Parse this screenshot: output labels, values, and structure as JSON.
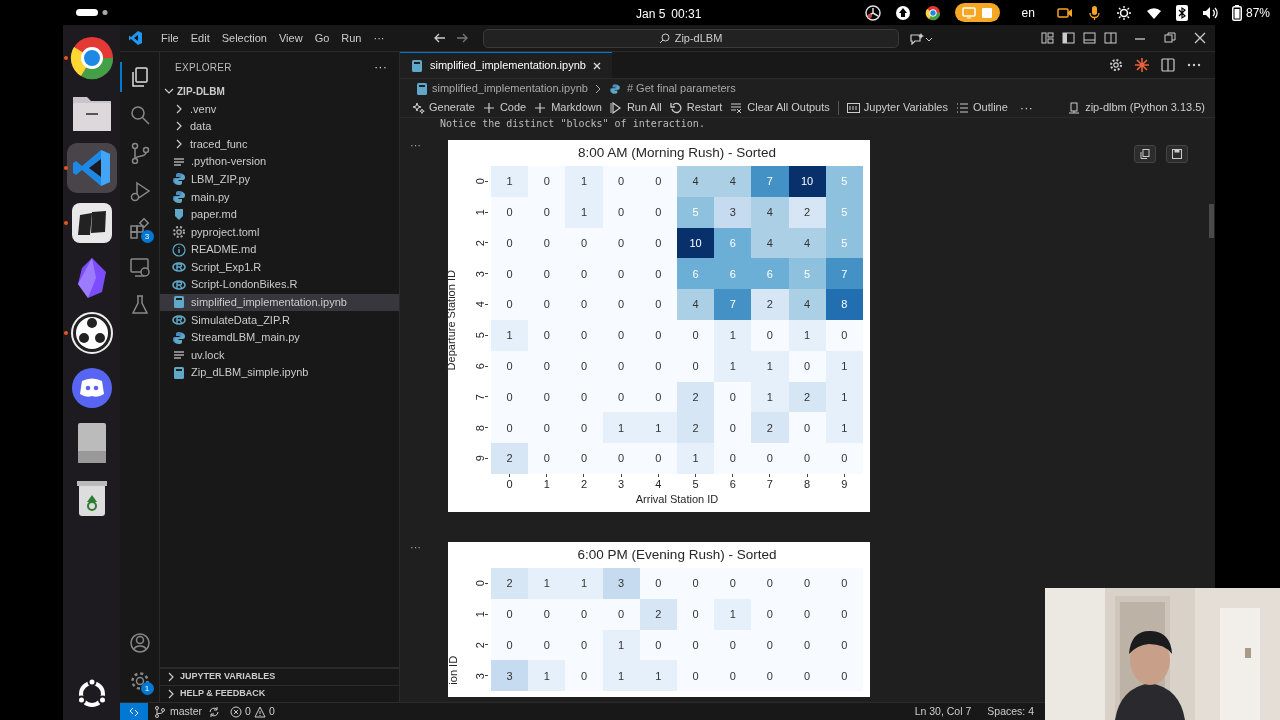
{
  "system_bar": {
    "date": "Jan 5",
    "time": "00:31",
    "language": "en",
    "battery": "87%"
  },
  "dock": {
    "items": [
      {
        "kind": "chrome",
        "running": true,
        "selected": false
      },
      {
        "kind": "files",
        "running": false,
        "selected": false
      },
      {
        "kind": "vscode",
        "running": true,
        "selected": true
      },
      {
        "kind": "tablet",
        "running": true,
        "selected": false
      },
      {
        "kind": "crystal",
        "running": false,
        "selected": false
      },
      {
        "kind": "obs",
        "running": true,
        "selected": false
      },
      {
        "kind": "discord",
        "running": false,
        "selected": false
      },
      {
        "kind": "drive",
        "running": false,
        "selected": false
      },
      {
        "kind": "trash",
        "running": false,
        "selected": false
      }
    ]
  },
  "menu": [
    "File",
    "Edit",
    "Selection",
    "View",
    "Go",
    "Run",
    "···"
  ],
  "command_center": "Zip-dLBM",
  "activity_bar": [
    {
      "kind": "files",
      "selected": true
    },
    {
      "kind": "search",
      "selected": false
    },
    {
      "kind": "branch",
      "selected": false
    },
    {
      "kind": "debug",
      "selected": false
    },
    {
      "kind": "extensions",
      "selected": false,
      "badge": "3"
    },
    {
      "kind": "remote",
      "selected": false
    },
    {
      "kind": "flask",
      "selected": false
    }
  ],
  "activity_bottom": [
    {
      "kind": "account"
    },
    {
      "kind": "settings",
      "badge": "1"
    }
  ],
  "explorer": {
    "title": "EXPLORER",
    "menu": "···",
    "root": "ZIP-DLBM",
    "items": [
      {
        "label": ".venv",
        "kind": "folder",
        "selected": false
      },
      {
        "label": "data",
        "kind": "folder",
        "selected": false
      },
      {
        "label": "traced_func",
        "kind": "folder",
        "selected": false
      },
      {
        "label": ".python-version",
        "kind": "text",
        "selected": false
      },
      {
        "label": "LBM_ZIP.py",
        "kind": "python",
        "selected": false
      },
      {
        "label": "main.py",
        "kind": "python",
        "selected": false
      },
      {
        "label": "paper.md",
        "kind": "markdown",
        "selected": false
      },
      {
        "label": "pyproject.toml",
        "kind": "gear",
        "selected": false
      },
      {
        "label": "README.md",
        "kind": "info",
        "selected": false
      },
      {
        "label": "Script_Exp1.R",
        "kind": "r",
        "selected": false
      },
      {
        "label": "Script-LondonBikes.R",
        "kind": "r",
        "selected": false
      },
      {
        "label": "simplified_implementation.ipynb",
        "kind": "notebook",
        "selected": true
      },
      {
        "label": "SimulateData_ZIP.R",
        "kind": "r",
        "selected": false
      },
      {
        "label": "StreamdLBM_main.py",
        "kind": "python",
        "selected": false
      },
      {
        "label": "uv.lock",
        "kind": "text",
        "selected": false
      },
      {
        "label": "Zip_dLBM_simple.ipynb",
        "kind": "notebook",
        "selected": false
      }
    ]
  },
  "sidebar_sections": [
    "JUPYTER VARIABLES",
    "HELP & FEEDBACK"
  ],
  "tabs": [
    {
      "label": "simplified_implementation.ipynb",
      "selected": true
    }
  ],
  "breadcrumbs": [
    "simplified_implementation.ipynb",
    "# Get final parameters"
  ],
  "toolbar": [
    {
      "label": "Generate",
      "kind": "sparkle"
    },
    {
      "label": "Code",
      "kind": "plus"
    },
    {
      "label": "Markdown",
      "kind": "plus"
    },
    {
      "label": "Run All",
      "kind": "run"
    },
    {
      "label": "Restart",
      "kind": "restart"
    },
    {
      "label": "Clear All Outputs",
      "kind": "clear"
    },
    {
      "label": "Jupyter Variables",
      "kind": "variables"
    },
    {
      "label": "Outline",
      "kind": "outline"
    }
  ],
  "toolbar_more": "···",
  "kernel": "zip-dlbm (Python 3.13.5)",
  "notebook": {
    "note": "Notice the distinct \"blocks\" of interaction.",
    "cell_menu": "···",
    "outputs": [
      {
        "title": "8:00 AM (Morning Rush) - Sorted",
        "xlabel": "Arrival Station ID",
        "ylabel": "Departure Station ID",
        "xticks": [
          "0",
          "1",
          "2",
          "3",
          "4",
          "5",
          "6",
          "7",
          "8",
          "9"
        ],
        "yticks": [
          "0",
          "1",
          "2",
          "3",
          "4",
          "5",
          "6",
          "7",
          "8",
          "9"
        ],
        "rows": [
          [
            "1",
            "0",
            "1",
            "0",
            "0",
            "4",
            "4",
            "7",
            "10",
            "5"
          ],
          [
            "0",
            "0",
            "1",
            "0",
            "0",
            "5",
            "3",
            "4",
            "2",
            "5"
          ],
          [
            "0",
            "0",
            "0",
            "0",
            "0",
            "10",
            "6",
            "4",
            "4",
            "5"
          ],
          [
            "0",
            "0",
            "0",
            "0",
            "0",
            "6",
            "6",
            "6",
            "5",
            "7"
          ],
          [
            "0",
            "0",
            "0",
            "0",
            "0",
            "4",
            "7",
            "2",
            "4",
            "8"
          ],
          [
            "1",
            "0",
            "0",
            "0",
            "0",
            "0",
            "1",
            "0",
            "1",
            "0"
          ],
          [
            "0",
            "0",
            "0",
            "0",
            "0",
            "0",
            "1",
            "1",
            "0",
            "1"
          ],
          [
            "0",
            "0",
            "0",
            "0",
            "0",
            "2",
            "0",
            "1",
            "2",
            "1"
          ],
          [
            "0",
            "0",
            "0",
            "1",
            "1",
            "2",
            "0",
            "2",
            "0",
            "1"
          ],
          [
            "2",
            "0",
            "0",
            "0",
            "0",
            "1",
            "0",
            "0",
            "0",
            "0"
          ]
        ]
      },
      {
        "title": "6:00 PM (Evening Rush) - Sorted",
        "ylabel": "ion ID",
        "yticks": [
          "0",
          "1",
          "2",
          "3"
        ],
        "rows": [
          [
            "2",
            "1",
            "1",
            "3",
            "0",
            "0",
            "0",
            "0",
            "0",
            "0"
          ],
          [
            "0",
            "0",
            "0",
            "0",
            "2",
            "0",
            "1",
            "0",
            "0",
            "0"
          ],
          [
            "0",
            "0",
            "0",
            "1",
            "0",
            "0",
            "0",
            "0",
            "0",
            "0"
          ],
          [
            "3",
            "1",
            "0",
            "1",
            "1",
            "0",
            "0",
            "0",
            "0",
            "0"
          ]
        ]
      }
    ]
  },
  "status_bar": {
    "branch": "master",
    "errors": "0",
    "warnings": "0",
    "position": "Ln 30, Col 7",
    "indent": "Spaces: 4"
  },
  "webcam": {
    "kind": "picture"
  }
}
